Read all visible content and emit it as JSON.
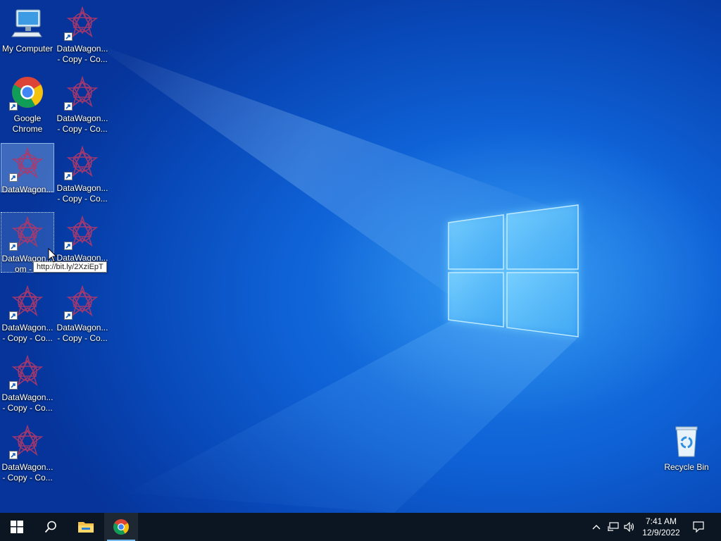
{
  "desktop": {
    "icons": [
      {
        "label": "My Computer",
        "kind": "computer"
      },
      {
        "label": "DataWagon...\n- Copy - Co...",
        "kind": "datawagon"
      },
      {
        "label": "Google\nChrome",
        "kind": "chrome"
      },
      {
        "label": "DataWagon...\n- Copy - Co...",
        "kind": "datawagon"
      },
      {
        "label": "DataWagon...",
        "kind": "datawagon"
      },
      {
        "label": "DataWagon...\n- Copy - Co...",
        "kind": "datawagon"
      },
      {
        "label": "DataWagon...\nom - C",
        "kind": "datawagon"
      },
      {
        "label": "DataWagon...",
        "kind": "datawagon"
      },
      {
        "label": "DataWagon...\n- Copy - Co...",
        "kind": "datawagon"
      },
      {
        "label": "DataWagon...\n- Copy - Co...",
        "kind": "datawagon"
      },
      {
        "label": "DataWagon...\n- Copy - Co...",
        "kind": "datawagon"
      },
      {
        "label": "DataWagon...\n- Copy - Co...",
        "kind": "datawagon"
      },
      {
        "label": "Recycle Bin",
        "kind": "recycle"
      }
    ],
    "tooltip": "http://bit.ly/2XziEpT"
  },
  "taskbar": {
    "start": "start-icon",
    "search": "search-icon",
    "pinned": [
      "file-explorer-icon",
      "chrome-icon"
    ],
    "tray": [
      "chevron-up-icon",
      "network-icon",
      "volume-icon"
    ],
    "time": "7:41 AM",
    "date": "12/9/2022",
    "notification": "action-center-icon"
  },
  "colors": {
    "taskbar": "#0b1622",
    "accent": "#76b9ed",
    "wallpaper": "#0a63d8"
  }
}
